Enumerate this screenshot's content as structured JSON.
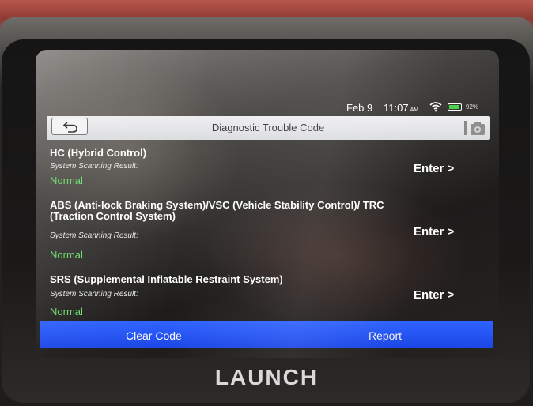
{
  "status": {
    "date": "Feb 9",
    "time": "11:07",
    "ampm": "AM",
    "battery_pct": "92%",
    "battery_level": 0.92,
    "icons": [
      "wifi-icon",
      "battery-icon"
    ]
  },
  "header": {
    "title": "Diagnostic Trouble Code",
    "back_icon": "back-arrow-icon",
    "camera_icon": "camera-icon"
  },
  "systems": [
    {
      "name": "HC (Hybrid Control)",
      "scan_label": "System Scanning Result:",
      "result": "Normal",
      "enter": "Enter >"
    },
    {
      "name": "ABS (Anti-lock Braking System)/VSC (Vehicle Stability Control)/ TRC (Traction Control System)",
      "scan_label": "System Scanning Result:",
      "result": "Normal",
      "enter": "Enter >"
    },
    {
      "name": "SRS (Supplemental Inflatable Restraint System)",
      "scan_label": "System Scanning Result:",
      "result": "Normal",
      "enter": "Enter >"
    }
  ],
  "footer": {
    "clear_code": "Clear Code",
    "report": "Report"
  },
  "device": {
    "brand": "LAUNCH"
  },
  "colors": {
    "accent_bar": "#1f4cf0",
    "normal_status": "#6edc6e",
    "title_bar": "#e6e7ea"
  }
}
